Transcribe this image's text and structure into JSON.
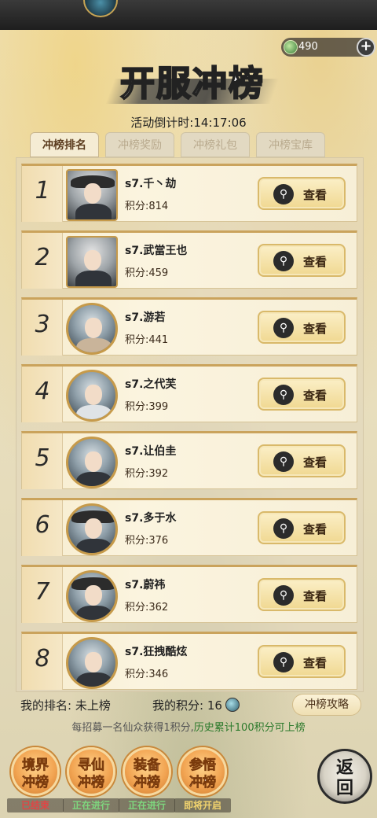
{
  "currency": {
    "amount": "490"
  },
  "title": "开服冲榜",
  "countdown": {
    "label": "活动倒计时:",
    "time": "14:17:06"
  },
  "tabs": [
    {
      "label": "冲榜排名",
      "active": true
    },
    {
      "label": "冲榜奖励",
      "active": false
    },
    {
      "label": "冲榜礼包",
      "active": false
    },
    {
      "label": "冲榜宝库",
      "active": false
    }
  ],
  "ranking": [
    {
      "rank": "1",
      "name": "s7.千丶劫",
      "score": "积分:814",
      "view": "查看"
    },
    {
      "rank": "2",
      "name": "s7.武當王也",
      "score": "积分:459",
      "view": "查看"
    },
    {
      "rank": "3",
      "name": "s7.游若",
      "score": "积分:441",
      "view": "查看"
    },
    {
      "rank": "4",
      "name": "s7.之代芙",
      "score": "积分:399",
      "view": "查看"
    },
    {
      "rank": "5",
      "name": "s7.让伯圭",
      "score": "积分:392",
      "view": "查看"
    },
    {
      "rank": "6",
      "name": "s7.多于水",
      "score": "积分:376",
      "view": "查看"
    },
    {
      "rank": "7",
      "name": "s7.蔚祎",
      "score": "积分:362",
      "view": "查看"
    },
    {
      "rank": "8",
      "name": "s7.狂拽酷炫",
      "score": "积分:346",
      "view": "查看"
    }
  ],
  "my": {
    "rank_label": "我的排名:",
    "rank_value": "未上榜",
    "score_label": "我的积分:",
    "score_value": "16"
  },
  "guide_label": "冲榜攻略",
  "tip": {
    "prefix": "每招募一名仙众获得1积分,",
    "highlight": "历史累计100积分可上榜"
  },
  "bottom_buttons": [
    {
      "line1": "境界",
      "line2": "冲榜",
      "status": "已结束"
    },
    {
      "line1": "寻仙",
      "line2": "冲榜",
      "status": "正在进行"
    },
    {
      "line1": "装备",
      "line2": "冲榜",
      "status": "正在进行"
    },
    {
      "line1": "参悟",
      "line2": "冲榜",
      "status": "即将开启"
    }
  ],
  "back": {
    "line1": "返",
    "line2": "回"
  }
}
